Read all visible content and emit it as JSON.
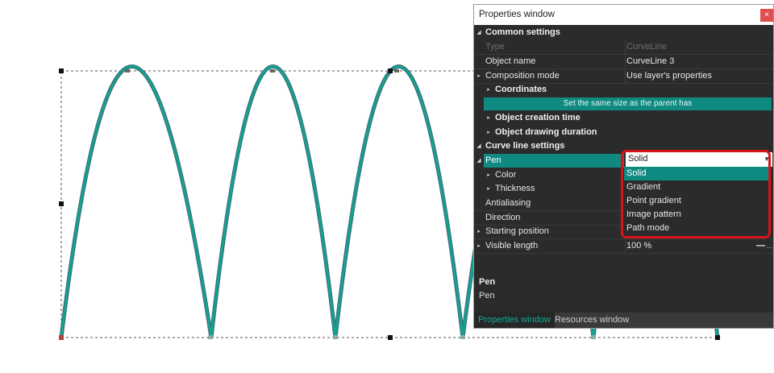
{
  "window": {
    "title": "Properties window",
    "close_label": "×"
  },
  "sections": {
    "common": "Common settings",
    "curve": "Curve line settings"
  },
  "rows": {
    "type": {
      "label": "Type",
      "value": "CurveLine"
    },
    "object_name": {
      "label": "Object name",
      "value": "CurveLine 3"
    },
    "composition_mode": {
      "label": "Composition mode",
      "value": "Use layer's properties"
    },
    "coordinates": {
      "label": "Coordinates"
    },
    "same_size": {
      "label": "Set the same size as the parent has"
    },
    "creation_time": {
      "label": "Object creation time"
    },
    "drawing_duration": {
      "label": "Object drawing duration"
    },
    "pen": {
      "label": "Pen",
      "value": "Solid"
    },
    "color": {
      "label": "Color"
    },
    "thickness": {
      "label": "Thickness"
    },
    "antialiasing": {
      "label": "Antialiasing"
    },
    "direction": {
      "label": "Direction"
    },
    "starting_position": {
      "label": "Starting position"
    },
    "visible_length": {
      "label": "Visible length",
      "value": "100 %"
    }
  },
  "pen_options": [
    "Solid",
    "Gradient",
    "Point gradient",
    "Image pattern",
    "Path mode"
  ],
  "pen_selected": "Solid",
  "description": {
    "title": "Pen",
    "text": "Pen"
  },
  "tabs": {
    "properties": "Properties window",
    "resources": "Resources window"
  },
  "icons": {
    "expand": "triangle-right-icon",
    "collapse": "triangle-down-icon",
    "dropdown": "chevron-down-icon"
  },
  "colors": {
    "curve": "#0f8a80",
    "accent": "#0f8a80",
    "highlight": "#d7141a",
    "panel_bg": "#2b2b2b"
  }
}
